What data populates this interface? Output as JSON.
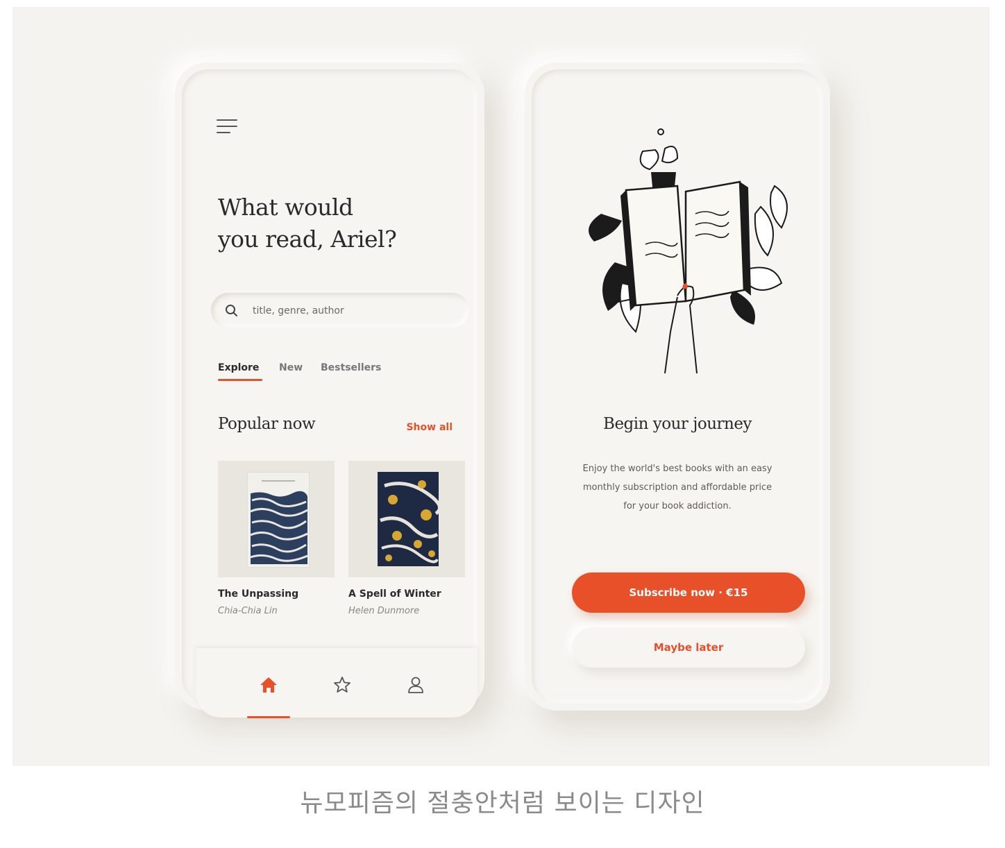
{
  "app": {
    "headline_line1": "What would",
    "headline_line2": "you read, Ariel?",
    "search": {
      "placeholder": "title, genre, author"
    },
    "tabs": [
      {
        "label": "Explore",
        "active": true
      },
      {
        "label": "New",
        "active": false
      },
      {
        "label": "Bestsellers",
        "active": false
      }
    ],
    "popular": {
      "title": "Popular now",
      "show_all": "Show all",
      "books": [
        {
          "title": "The Unpassing",
          "author": "Chia-Chia Lin"
        },
        {
          "title": "A Spell of Winter",
          "author": "Helen Dunmore"
        }
      ]
    },
    "bottom_nav": [
      "home-icon",
      "star-icon",
      "user-icon"
    ]
  },
  "onboarding": {
    "title": "Begin your journey",
    "body_line1": "Enjoy the world's best books with an easy",
    "body_line2": "monthly subscription and affordable price",
    "body_line3": "for your book addiction.",
    "primary_button": "Subscribe now · €15",
    "secondary_button": "Maybe later"
  },
  "colors": {
    "accent": "#e8502a",
    "background": "#f4f3ef",
    "text": "#2b2a28"
  },
  "caption": "뉴모피즘의 절충안처럼 보이는 디자인"
}
